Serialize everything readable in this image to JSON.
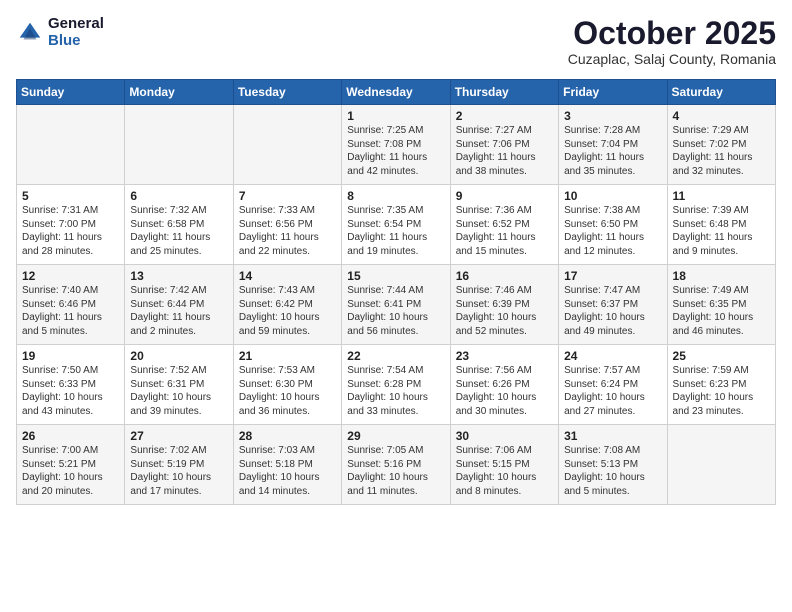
{
  "logo": {
    "general": "General",
    "blue": "Blue"
  },
  "header": {
    "title": "October 2025",
    "subtitle": "Cuzaplac, Salaj County, Romania"
  },
  "days_of_week": [
    "Sunday",
    "Monday",
    "Tuesday",
    "Wednesday",
    "Thursday",
    "Friday",
    "Saturday"
  ],
  "weeks": [
    [
      {
        "day": "",
        "info": ""
      },
      {
        "day": "",
        "info": ""
      },
      {
        "day": "",
        "info": ""
      },
      {
        "day": "1",
        "info": "Sunrise: 7:25 AM\nSunset: 7:08 PM\nDaylight: 11 hours\nand 42 minutes."
      },
      {
        "day": "2",
        "info": "Sunrise: 7:27 AM\nSunset: 7:06 PM\nDaylight: 11 hours\nand 38 minutes."
      },
      {
        "day": "3",
        "info": "Sunrise: 7:28 AM\nSunset: 7:04 PM\nDaylight: 11 hours\nand 35 minutes."
      },
      {
        "day": "4",
        "info": "Sunrise: 7:29 AM\nSunset: 7:02 PM\nDaylight: 11 hours\nand 32 minutes."
      }
    ],
    [
      {
        "day": "5",
        "info": "Sunrise: 7:31 AM\nSunset: 7:00 PM\nDaylight: 11 hours\nand 28 minutes."
      },
      {
        "day": "6",
        "info": "Sunrise: 7:32 AM\nSunset: 6:58 PM\nDaylight: 11 hours\nand 25 minutes."
      },
      {
        "day": "7",
        "info": "Sunrise: 7:33 AM\nSunset: 6:56 PM\nDaylight: 11 hours\nand 22 minutes."
      },
      {
        "day": "8",
        "info": "Sunrise: 7:35 AM\nSunset: 6:54 PM\nDaylight: 11 hours\nand 19 minutes."
      },
      {
        "day": "9",
        "info": "Sunrise: 7:36 AM\nSunset: 6:52 PM\nDaylight: 11 hours\nand 15 minutes."
      },
      {
        "day": "10",
        "info": "Sunrise: 7:38 AM\nSunset: 6:50 PM\nDaylight: 11 hours\nand 12 minutes."
      },
      {
        "day": "11",
        "info": "Sunrise: 7:39 AM\nSunset: 6:48 PM\nDaylight: 11 hours\nand 9 minutes."
      }
    ],
    [
      {
        "day": "12",
        "info": "Sunrise: 7:40 AM\nSunset: 6:46 PM\nDaylight: 11 hours\nand 5 minutes."
      },
      {
        "day": "13",
        "info": "Sunrise: 7:42 AM\nSunset: 6:44 PM\nDaylight: 11 hours\nand 2 minutes."
      },
      {
        "day": "14",
        "info": "Sunrise: 7:43 AM\nSunset: 6:42 PM\nDaylight: 10 hours\nand 59 minutes."
      },
      {
        "day": "15",
        "info": "Sunrise: 7:44 AM\nSunset: 6:41 PM\nDaylight: 10 hours\nand 56 minutes."
      },
      {
        "day": "16",
        "info": "Sunrise: 7:46 AM\nSunset: 6:39 PM\nDaylight: 10 hours\nand 52 minutes."
      },
      {
        "day": "17",
        "info": "Sunrise: 7:47 AM\nSunset: 6:37 PM\nDaylight: 10 hours\nand 49 minutes."
      },
      {
        "day": "18",
        "info": "Sunrise: 7:49 AM\nSunset: 6:35 PM\nDaylight: 10 hours\nand 46 minutes."
      }
    ],
    [
      {
        "day": "19",
        "info": "Sunrise: 7:50 AM\nSunset: 6:33 PM\nDaylight: 10 hours\nand 43 minutes."
      },
      {
        "day": "20",
        "info": "Sunrise: 7:52 AM\nSunset: 6:31 PM\nDaylight: 10 hours\nand 39 minutes."
      },
      {
        "day": "21",
        "info": "Sunrise: 7:53 AM\nSunset: 6:30 PM\nDaylight: 10 hours\nand 36 minutes."
      },
      {
        "day": "22",
        "info": "Sunrise: 7:54 AM\nSunset: 6:28 PM\nDaylight: 10 hours\nand 33 minutes."
      },
      {
        "day": "23",
        "info": "Sunrise: 7:56 AM\nSunset: 6:26 PM\nDaylight: 10 hours\nand 30 minutes."
      },
      {
        "day": "24",
        "info": "Sunrise: 7:57 AM\nSunset: 6:24 PM\nDaylight: 10 hours\nand 27 minutes."
      },
      {
        "day": "25",
        "info": "Sunrise: 7:59 AM\nSunset: 6:23 PM\nDaylight: 10 hours\nand 23 minutes."
      }
    ],
    [
      {
        "day": "26",
        "info": "Sunrise: 7:00 AM\nSunset: 5:21 PM\nDaylight: 10 hours\nand 20 minutes."
      },
      {
        "day": "27",
        "info": "Sunrise: 7:02 AM\nSunset: 5:19 PM\nDaylight: 10 hours\nand 17 minutes."
      },
      {
        "day": "28",
        "info": "Sunrise: 7:03 AM\nSunset: 5:18 PM\nDaylight: 10 hours\nand 14 minutes."
      },
      {
        "day": "29",
        "info": "Sunrise: 7:05 AM\nSunset: 5:16 PM\nDaylight: 10 hours\nand 11 minutes."
      },
      {
        "day": "30",
        "info": "Sunrise: 7:06 AM\nSunset: 5:15 PM\nDaylight: 10 hours\nand 8 minutes."
      },
      {
        "day": "31",
        "info": "Sunrise: 7:08 AM\nSunset: 5:13 PM\nDaylight: 10 hours\nand 5 minutes."
      },
      {
        "day": "",
        "info": ""
      }
    ]
  ]
}
